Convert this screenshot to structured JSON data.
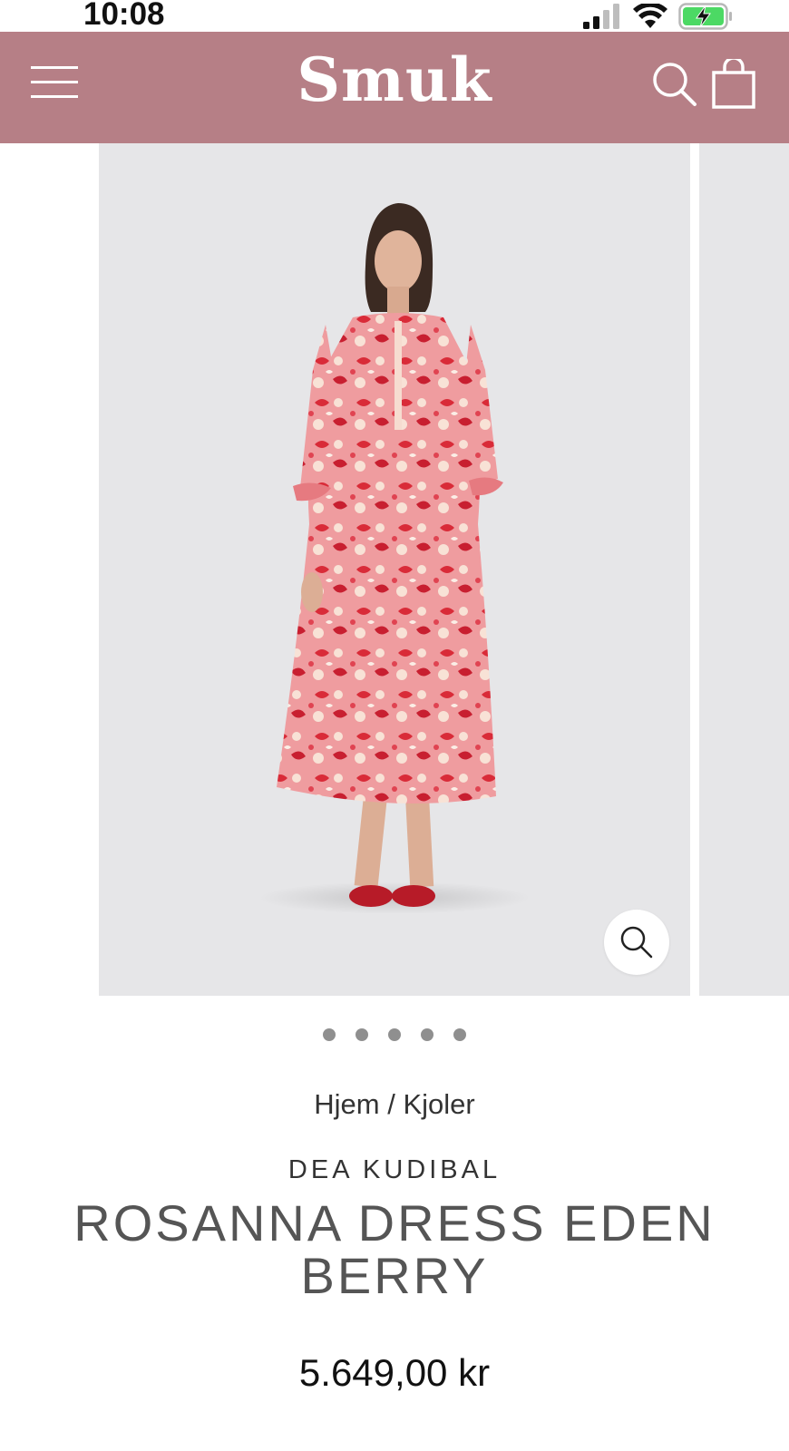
{
  "status_bar": {
    "time": "10:08",
    "icons": [
      "signal-icon",
      "wifi-icon",
      "battery-charging-icon"
    ]
  },
  "header": {
    "logo": "Smuk",
    "background_color": "#b67f86",
    "menu_icon": "hamburger-icon",
    "search_icon": "search-icon",
    "cart_icon": "shopping-bag-icon"
  },
  "gallery": {
    "image_count": 5,
    "active_index": 0,
    "zoom_icon": "zoom-icon",
    "dress_colors": [
      "#f0a1a1",
      "#d9303b",
      "#f8e3d8"
    ]
  },
  "breadcrumb": {
    "home": "Hjem",
    "separator": "/",
    "category": "Kjoler"
  },
  "product": {
    "brand": "DEA KUDIBAL",
    "title": "ROSANNA DRESS EDEN BERRY",
    "price": "5.649,00 kr"
  }
}
